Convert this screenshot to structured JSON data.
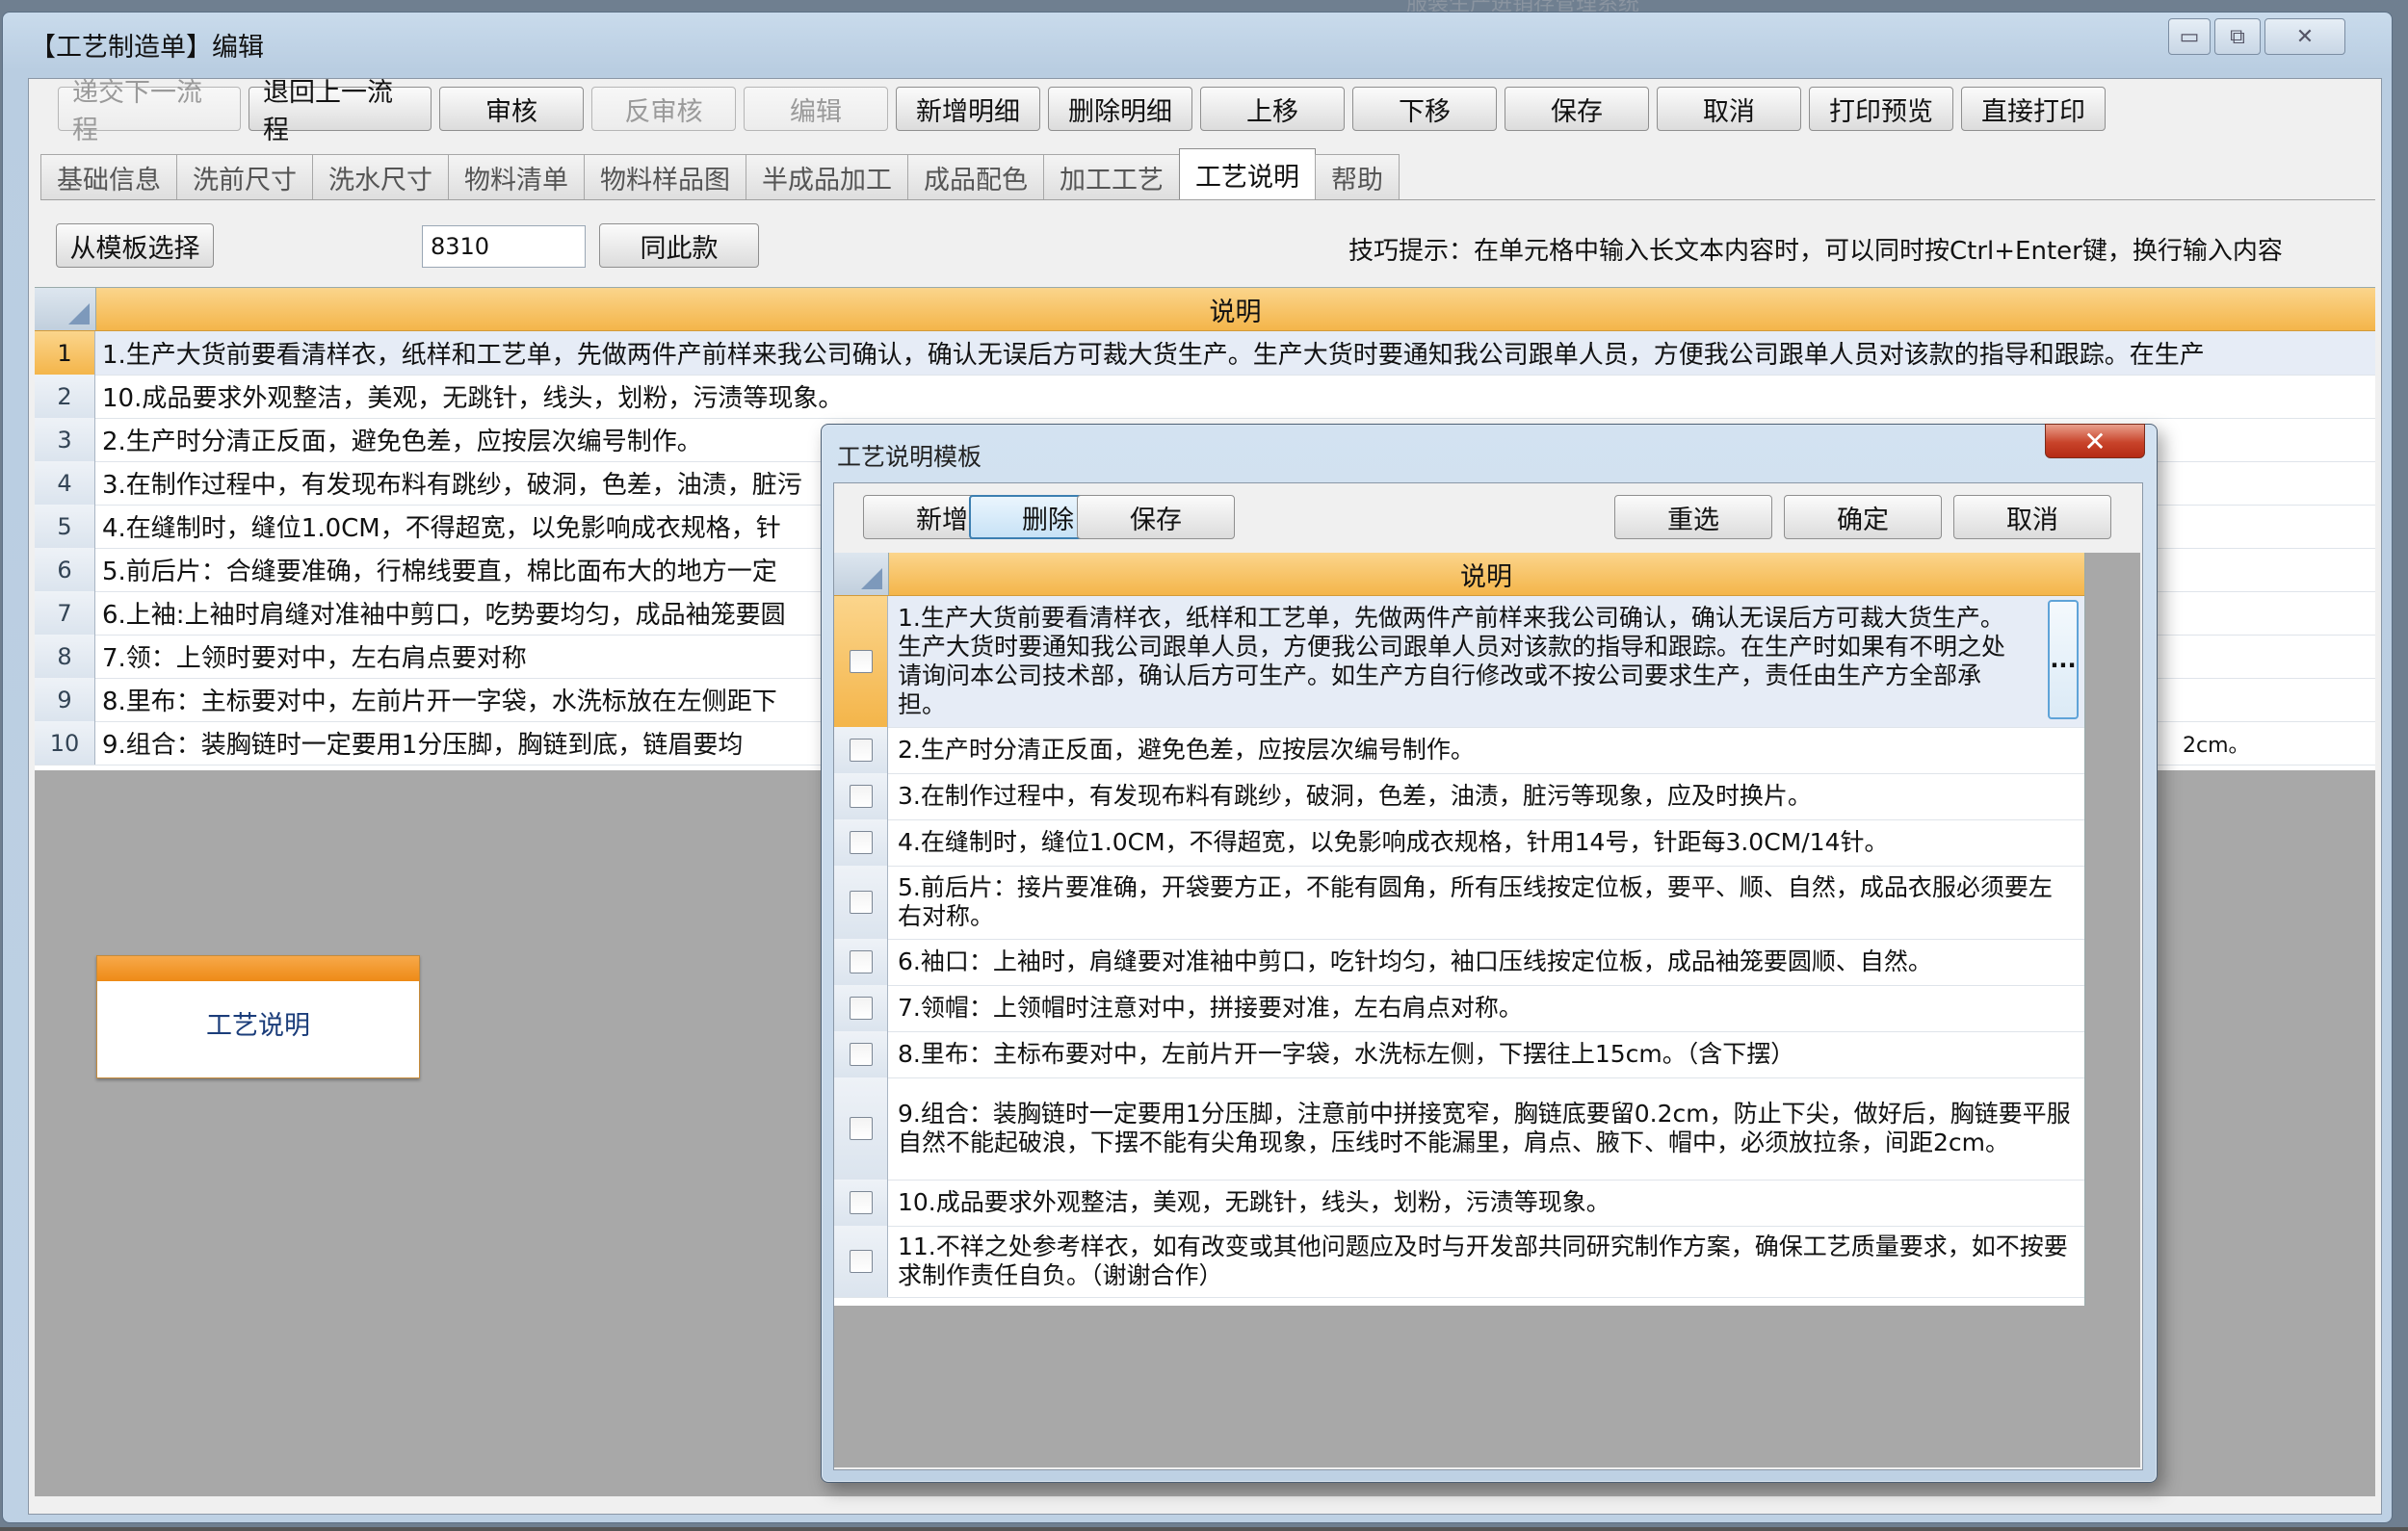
{
  "background_window_title": "服装生产进销存管理系统",
  "window": {
    "title": "【工艺制造单】编辑",
    "minimize": "▭",
    "maximize": "⧉",
    "close": "✕"
  },
  "toolbar": [
    {
      "label": "递交下一流程",
      "enabled": false
    },
    {
      "label": "退回上一流程",
      "enabled": true
    },
    {
      "label": "审核",
      "enabled": true
    },
    {
      "label": "反审核",
      "enabled": false
    },
    {
      "label": "编辑",
      "enabled": false
    },
    {
      "label": "新增明细",
      "enabled": true
    },
    {
      "label": "删除明细",
      "enabled": true
    },
    {
      "label": "上移",
      "enabled": true
    },
    {
      "label": "下移",
      "enabled": true
    },
    {
      "label": "保存",
      "enabled": true
    },
    {
      "label": "取消",
      "enabled": true
    },
    {
      "label": "打印预览",
      "enabled": true
    },
    {
      "label": "直接打印",
      "enabled": true
    }
  ],
  "tabs": [
    {
      "label": "基础信息",
      "active": false
    },
    {
      "label": "洗前尺寸",
      "active": false
    },
    {
      "label": "洗水尺寸",
      "active": false
    },
    {
      "label": "物料清单",
      "active": false
    },
    {
      "label": "物料样品图",
      "active": false
    },
    {
      "label": "半成品加工",
      "active": false
    },
    {
      "label": "成品配色",
      "active": false
    },
    {
      "label": "加工工艺",
      "active": false
    },
    {
      "label": "工艺说明",
      "active": true
    },
    {
      "label": "帮助",
      "active": false
    }
  ],
  "controls": {
    "template_button": "从模板选择",
    "style_value": "8310",
    "same_style_button": "同此款",
    "tip": "技巧提示：在单元格中输入长文本内容时，可以同时按Ctrl+Enter键，换行输入内容"
  },
  "grid": {
    "header": "说明",
    "rows": [
      {
        "num": "1",
        "text": "1.生产大货前要看清样衣，纸样和工艺单，先做两件产前样来我公司确认，确认无误后方可裁大货生产。生产大货时要通知我公司跟单人员，方便我公司跟单人员对该款的指导和跟踪。在生产"
      },
      {
        "num": "2",
        "text": "10.成品要求外观整洁，美观，无跳针，线头，划粉，污渍等现象。"
      },
      {
        "num": "3",
        "text": "2.生产时分清正反面，避免色差，应按层次编号制作。"
      },
      {
        "num": "4",
        "text": "3.在制作过程中，有发现布料有跳纱，破洞，色差，油渍，脏污"
      },
      {
        "num": "5",
        "text": "4.在缝制时，缝位1.0CM，不得超宽，以免影响成衣规格，针"
      },
      {
        "num": "6",
        "text": "5.前后片：合缝要准确，行棉线要直，棉比面布大的地方一定"
      },
      {
        "num": "7",
        "text": "6.上袖:上袖时肩缝对准袖中剪口，吃势要均匀，成品袖笼要圆"
      },
      {
        "num": "8",
        "text": "7.领：上领时要对中，左右肩点要对称"
      },
      {
        "num": "9",
        "text": "8.里布：主标要对中，左前片开一字袋，水洗标放在左侧距下"
      },
      {
        "num": "10",
        "text": "9.组合：装胸链时一定要用1分压脚，胸链到底，链眉要均",
        "tail": "2cm。"
      }
    ]
  },
  "side_card": {
    "label": "工艺说明"
  },
  "dialog": {
    "title": "工艺说明模板",
    "close": "✕",
    "buttons": {
      "add": "新增",
      "delete": "删除",
      "save": "保存",
      "reselect": "重选",
      "confirm": "确定",
      "cancel": "取消"
    },
    "grid_header": "说明",
    "ellipsis": "...",
    "rows": [
      "1.生产大货前要看清样衣，纸样和工艺单，先做两件产前样来我公司确认，确认无误后方可裁大货生产。生产大货时要通知我公司跟单人员，方便我公司跟单人员对该款的指导和跟踪。在生产时如果有不明之处请询问本公司技术部，确认后方可生产。如生产方自行修改或不按公司要求生产，责任由生产方全部承担。",
      "2.生产时分清正反面，避免色差，应按层次编号制作。",
      "3.在制作过程中，有发现布料有跳纱，破洞，色差，油渍，脏污等现象，应及时换片。",
      "4.在缝制时，缝位1.0CM，不得超宽，以免影响成衣规格，针用14号，针距每3.0CM/14针。",
      "5.前后片：接片要准确，开袋要方正，不能有圆角，所有压线按定位板，要平、顺、自然，成品衣服必须要左右对称。",
      "6.袖口：上袖时，肩缝要对准袖中剪口，吃针均匀，袖口压线按定位板，成品袖笼要圆顺、自然。",
      "7.领帽：上领帽时注意对中，拼接要对准，左右肩点对称。",
      "8.里布：主标布要对中，左前片开一字袋，水洗标左侧，下摆往上15cm。（含下摆）",
      "9.组合：装胸链时一定要用1分压脚，注意前中拼接宽窄，胸链底要留0.2cm，防止下尖，做好后，胸链要平服自然不能起破浪，下摆不能有尖角现象，压线时不能漏里，肩点、腋下、帽中，必须放拉条，间距2cm。",
      "10.成品要求外观整洁，美观，无跳针，线头，划粉，污渍等现象。",
      "11.不祥之处参考样衣，如有改变或其他问题应及时与开发部共同研究制作方案，确保工艺质量要求，如不按要求制作责任自负。（谢谢合作）"
    ]
  }
}
